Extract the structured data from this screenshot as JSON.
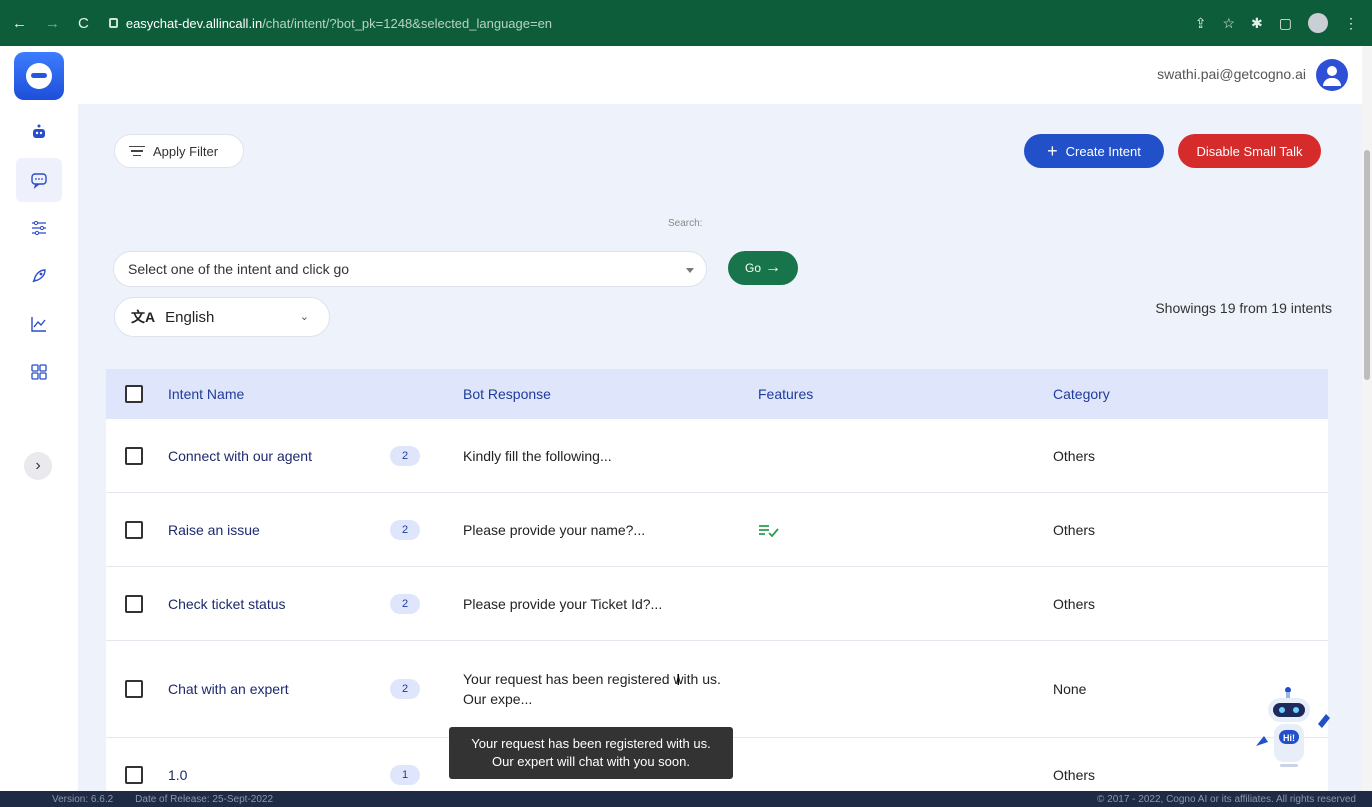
{
  "browser": {
    "url_host": "easychat-dev.allincall.in",
    "url_path": "/chat/intent/?bot_pk=1248&selected_language=en"
  },
  "header": {
    "user_email": "swathi.pai@getcogno.ai"
  },
  "toolbar": {
    "filter_label": "Apply Filter",
    "create_label": "Create Intent",
    "disable_label": "Disable Small Talk"
  },
  "search": {
    "label": "Search:",
    "select_placeholder": "Select one of the intent and click go",
    "go_label": "Go"
  },
  "language": {
    "selected": "English"
  },
  "summary": {
    "showing_text": "Showings 19 from 19 intents"
  },
  "table": {
    "headers": {
      "name": "Intent Name",
      "response": "Bot Response",
      "features": "Features",
      "category": "Category"
    },
    "rows": [
      {
        "name": "Connect with our agent",
        "count": "2",
        "response": "Kindly fill the following...",
        "category": "Others"
      },
      {
        "name": "Raise an issue",
        "count": "2",
        "response": "Please provide your name?...",
        "category": "Others"
      },
      {
        "name": "Check ticket status",
        "count": "2",
        "response": "Please provide your Ticket Id?...",
        "category": "Others"
      },
      {
        "name": "Chat with an expert",
        "count": "2",
        "response": "Your request has been registered with us. Our expe...",
        "category": "None"
      },
      {
        "name": "1.0",
        "count": "1",
        "response": "",
        "category": "Others"
      }
    ]
  },
  "tooltip": {
    "line1": "Your request has been registered with us.",
    "line2": "Our expert will chat with you soon."
  },
  "footer": {
    "version": "Version: 6.6.2",
    "release": "Date of Release: 25-Sept-2022",
    "copyright": "© 2017 - 2022, Cogno AI or its affiliates. All rights reserved"
  },
  "colors": {
    "primary": "#2150c9",
    "danger": "#d52b2b",
    "success": "#18744a",
    "chrome": "#0e5d3a"
  }
}
